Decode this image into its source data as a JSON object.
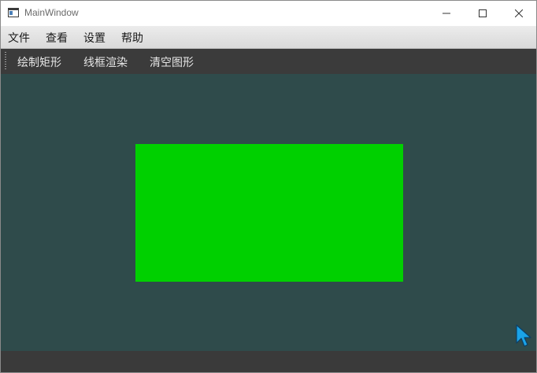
{
  "window": {
    "title": "MainWindow"
  },
  "menubar": {
    "items": [
      "文件",
      "查看",
      "设置",
      "帮助"
    ]
  },
  "toolbar": {
    "items": [
      "绘制矩形",
      "线框渲染",
      "清空图形"
    ]
  },
  "canvas": {
    "background_color": "#2f4b4b",
    "shape": {
      "type": "rectangle",
      "fill_color": "#00d000"
    }
  },
  "icons": {
    "app": "window-app-icon",
    "minimize": "minimize-icon",
    "maximize": "maximize-icon",
    "close": "close-icon",
    "cursor": "mouse-pointer-icon"
  }
}
